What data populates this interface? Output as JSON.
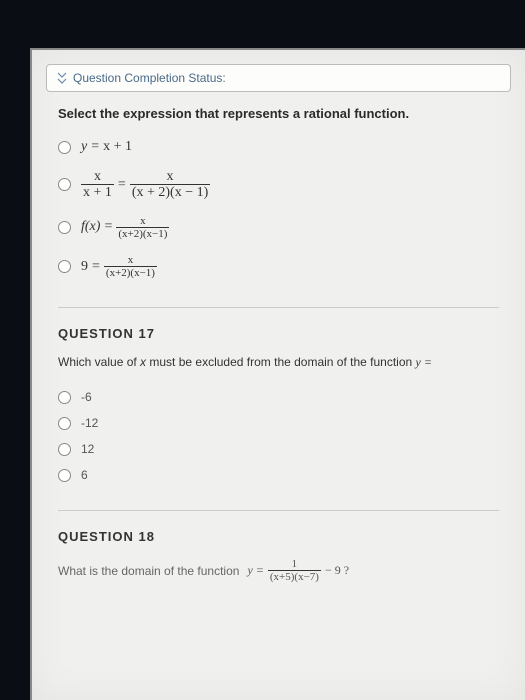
{
  "status": {
    "label": "Question Completion Status:"
  },
  "q16": {
    "prompt": "Select the expression that represents a rational function.",
    "options": {
      "a": {
        "lhs_y": "y",
        "eq": "=",
        "rhs": "x + 1"
      },
      "b": {
        "num1": "x",
        "den1": "x + 1",
        "eq": "=",
        "num2": "x",
        "den2": "(x + 2)(x − 1)"
      },
      "c": {
        "lhs": "f(x)",
        "eq": "=",
        "num": "x",
        "den": "(x+2)(x−1)"
      },
      "d": {
        "lhs": "9",
        "eq": "=",
        "num": "x",
        "den": "(x+2)(x−1)"
      }
    }
  },
  "q17": {
    "heading": "QUESTION 17",
    "prompt_prefix": "Which value of ",
    "prompt_var": "x",
    "prompt_suffix": " must be excluded from the domain of the function  ",
    "prompt_eq": "y =",
    "options": {
      "a": "-6",
      "b": "-12",
      "c": "12",
      "d": "6"
    }
  },
  "q18": {
    "heading": "QUESTION 18",
    "prompt": "What is the domain of the function  ",
    "eq_lhs": "y =",
    "num": "1",
    "den": "(x+5)(x−7)",
    "tail": "− 9 ?"
  }
}
